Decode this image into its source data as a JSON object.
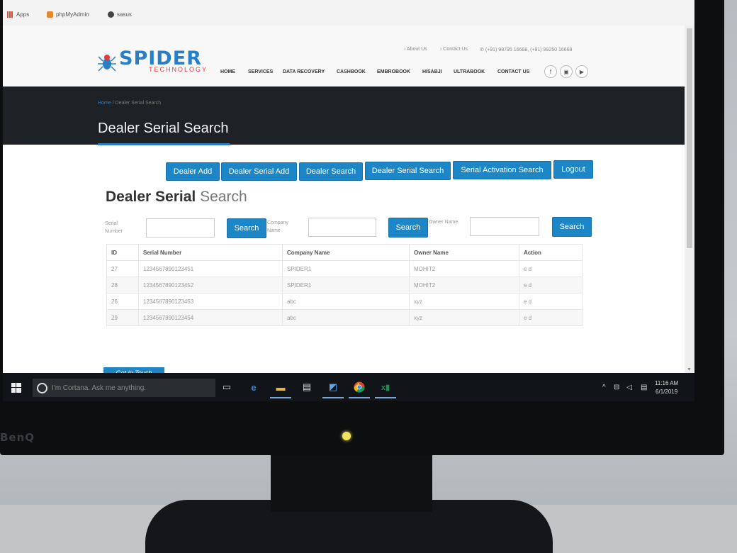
{
  "monitor": {
    "brand": "BenQ"
  },
  "bookmarks": [
    {
      "label": "Apps"
    },
    {
      "label": "phpMyAdmin"
    },
    {
      "label": "sasus"
    }
  ],
  "site": {
    "logo_main": "SPIDER",
    "logo_sub": "TECHNOLOGY",
    "top_links": {
      "about": "About Us",
      "contact": "Contact Us",
      "phone": "(+91) 98795 16668, (+91) 99250 16668"
    },
    "nav": [
      "HOME",
      "SERVICES",
      "DATA RECOVERY",
      "CASHBOOK",
      "EMBROBOOK",
      "HISABJI",
      "ULTRABOOK",
      "CONTACT US"
    ],
    "social": [
      "f",
      "▣",
      "▶"
    ]
  },
  "banner": {
    "breadcrumb_home": "Home",
    "breadcrumb_sep": "/",
    "breadcrumb_current": "Dealer Serial Search",
    "title": "Dealer Serial Search"
  },
  "actions": [
    "Dealer Add",
    "Dealer Serial Add",
    "Dealer Search",
    "Dealer Serial Search",
    "Serial Activation Search",
    "Logout"
  ],
  "section_title": {
    "bold": "Dealer Serial",
    "light": "Search"
  },
  "filters": [
    {
      "label": "Serial Number",
      "value": "",
      "button": "Search"
    },
    {
      "label": "Company Name",
      "value": "",
      "button": "Search"
    },
    {
      "label": "Owner Name",
      "value": "",
      "button": "Search"
    }
  ],
  "table": {
    "headers": [
      "ID",
      "Serial Number",
      "Company Name",
      "Owner Name",
      "Action"
    ],
    "rows": [
      [
        "27",
        "1234567890123451",
        "SPIDER1",
        "MOHIT2",
        "e d"
      ],
      [
        "28",
        "1234567890123452",
        "SPIDER1",
        "MOHIT2",
        "e d"
      ],
      [
        "26",
        "1234567890123453",
        "abc",
        "xyz",
        "e d"
      ],
      [
        "29",
        "1234567890123454",
        "abc",
        "xyz",
        "e d"
      ]
    ]
  },
  "get_in_touch": "Get in Touch",
  "taskbar": {
    "cortana_placeholder": "I'm Cortana. Ask me anything.",
    "time": "11:16 AM",
    "date": "6/1/2019",
    "tray_up": "^"
  },
  "colors": {
    "accent": "#1d86c7",
    "banner": "#1e2227",
    "logo_red": "#e03b3b"
  }
}
